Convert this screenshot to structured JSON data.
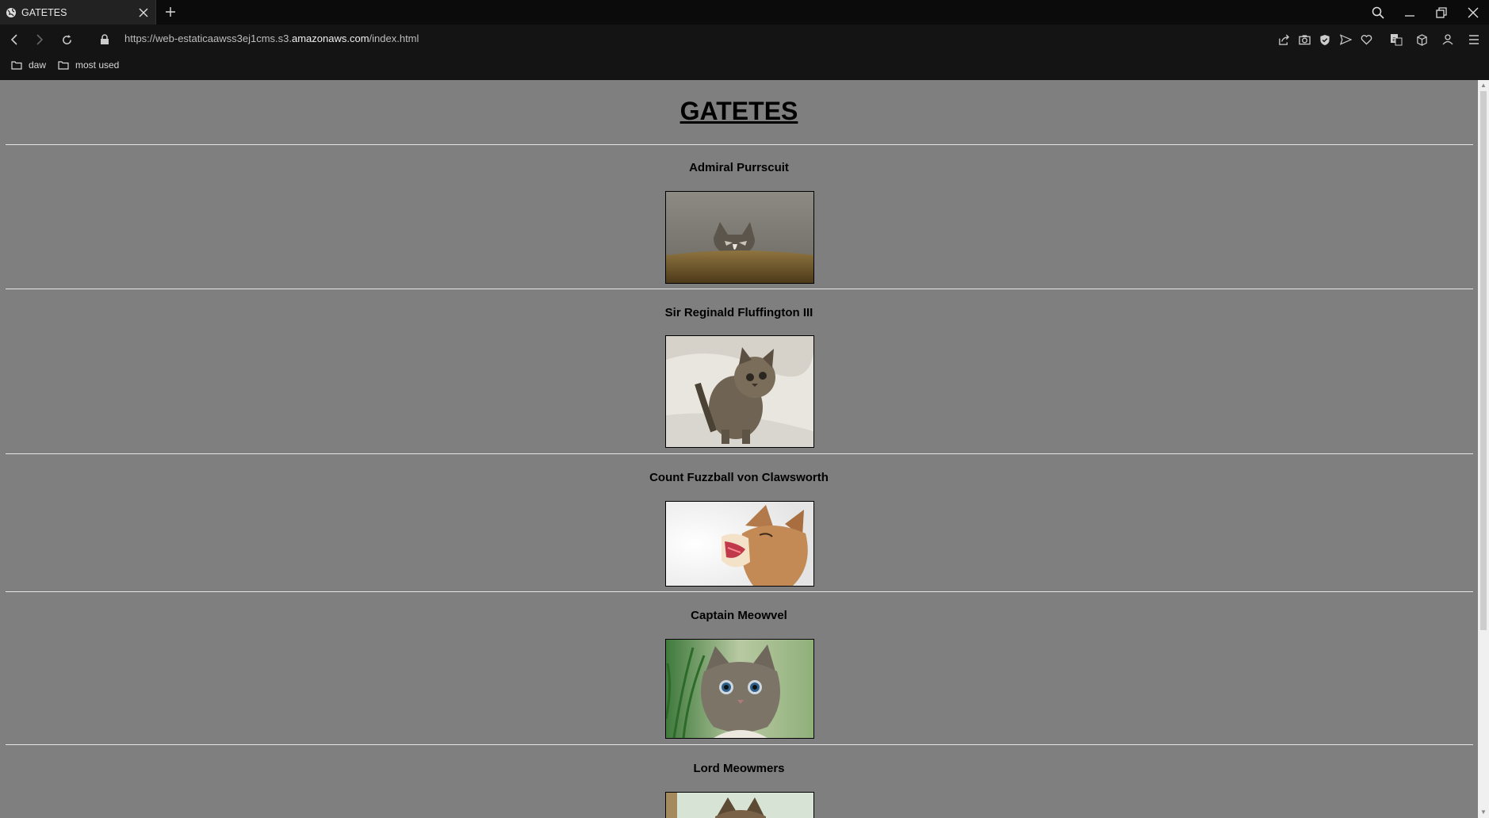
{
  "browser": {
    "tab_title": "GATETES",
    "url_prefix": "https://web-estaticaawss3ej1cms.s3.",
    "url_domain": "amazonaws.com",
    "url_suffix": "/index.html",
    "bookmarks": [
      "daw",
      "most used"
    ]
  },
  "page": {
    "heading": "GATETES",
    "cats": [
      {
        "name": "Admiral Purrscuit",
        "image": "kitten-peeking-over-couch"
      },
      {
        "name": "Sir Reginald Fluffington III",
        "image": "tabby-kitten-on-blanket"
      },
      {
        "name": "Count Fuzzball von Clawsworth",
        "image": "kitten-yawning"
      },
      {
        "name": "Captain Meowvel",
        "image": "blue-eyed-kitten-in-grass"
      },
      {
        "name": "Lord Meowmers",
        "image": "kitten-photo"
      }
    ]
  },
  "colors": {
    "page_background": "#7f7f7f",
    "chrome_background": "#141414",
    "divider": "#e6e6e6"
  }
}
